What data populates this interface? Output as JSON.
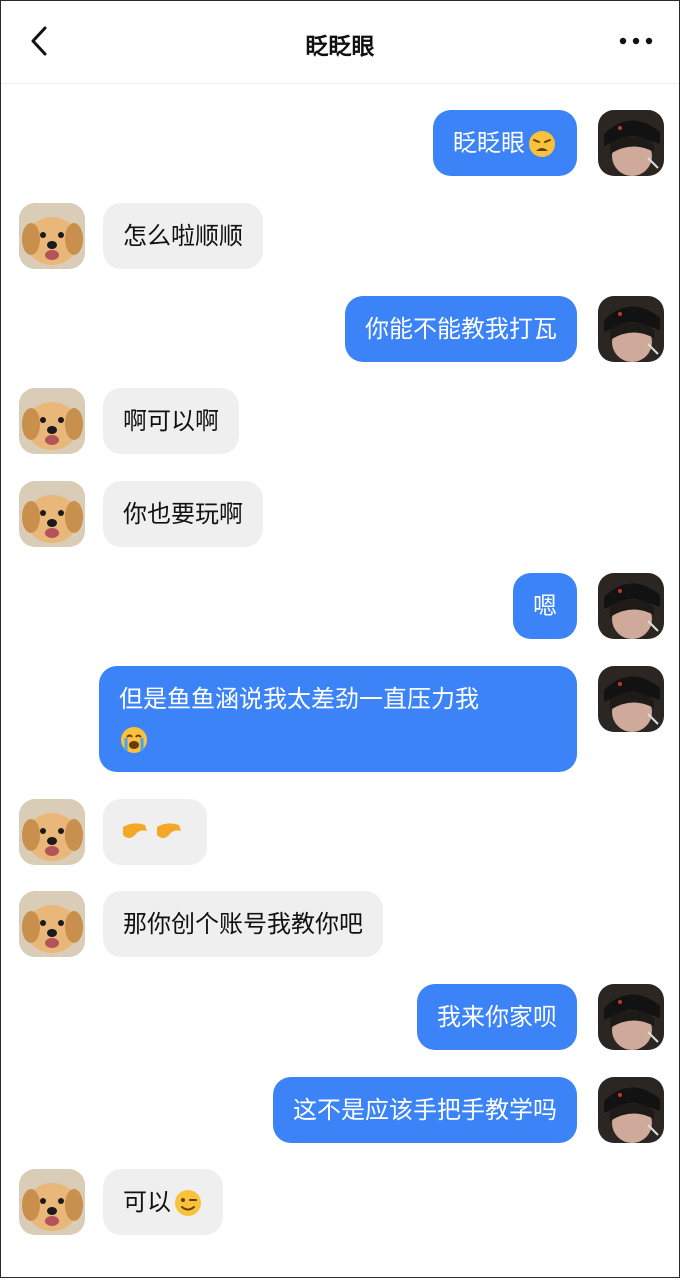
{
  "header": {
    "title": "眨眨眼"
  },
  "messages": [
    {
      "side": "out",
      "text": "眨眨眼",
      "emoji": "weary-face-emoji"
    },
    {
      "side": "in",
      "text": "怎么啦顺顺"
    },
    {
      "side": "out",
      "text": "你能不能教我打瓦"
    },
    {
      "side": "in",
      "text": "啊可以啊"
    },
    {
      "side": "in",
      "text": "你也要玩啊"
    },
    {
      "side": "out",
      "text": "嗯"
    },
    {
      "side": "out",
      "text": "但是鱼鱼涵说我太差劲一直压力我",
      "emoji": "loudly-crying-face-emoji"
    },
    {
      "side": "in",
      "text": "",
      "emoji": "pointing-hands-emoji"
    },
    {
      "side": "in",
      "text": "那你创个账号我教你吧"
    },
    {
      "side": "out",
      "text": "我来你家呗"
    },
    {
      "side": "out",
      "text": "这不是应该手把手教学吗"
    },
    {
      "side": "in",
      "text": "可以",
      "emoji": "winking-face-emoji"
    }
  ],
  "colors": {
    "outgoing_bubble": "#3b83f6",
    "incoming_bubble": "#efefef"
  }
}
